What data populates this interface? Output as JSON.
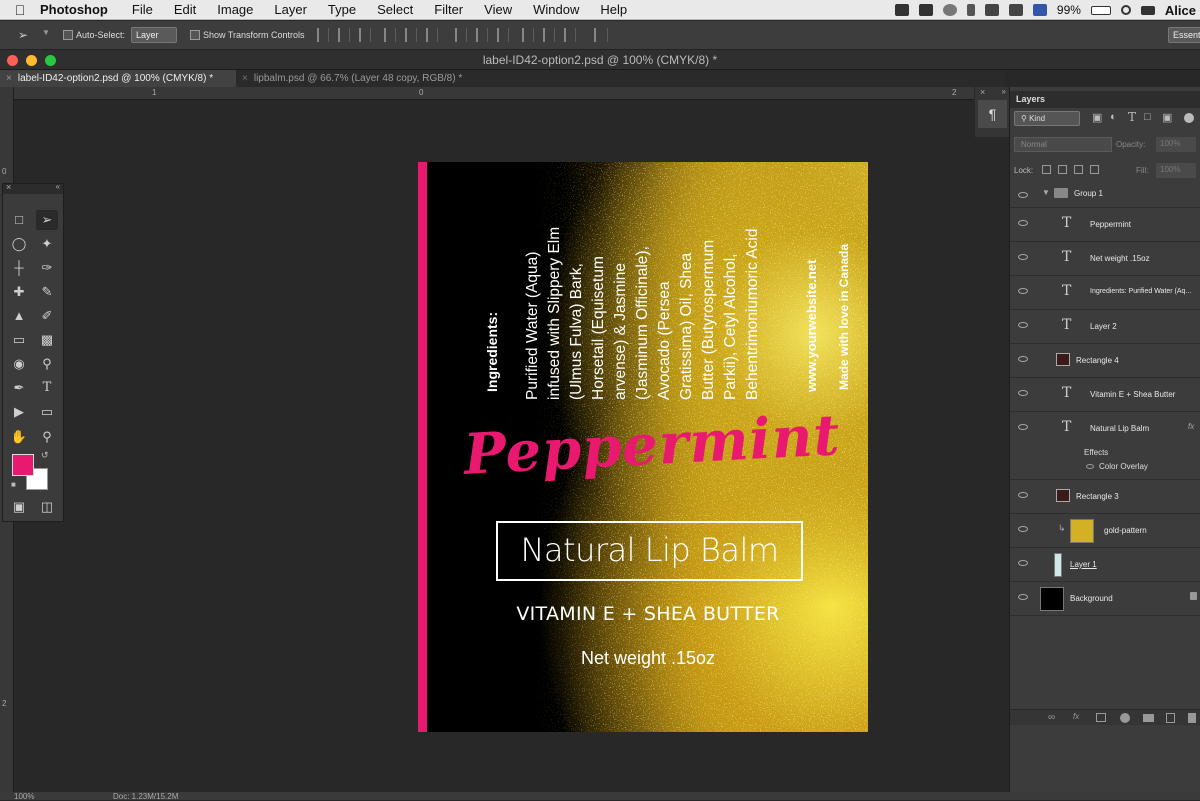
{
  "menubar": {
    "apple": "",
    "app_name": "Photoshop",
    "items": [
      "File",
      "Edit",
      "Image",
      "Layer",
      "Type",
      "Select",
      "Filter",
      "View",
      "Window",
      "Help"
    ],
    "battery": "99%",
    "user": "Alice"
  },
  "options_bar": {
    "auto_select_label": "Auto-Select:",
    "auto_select_value": "Layer",
    "show_transform_label": "Show Transform Controls",
    "workspace": "Essent"
  },
  "window": {
    "title": "label-ID42-option2.psd @ 100% (CMYK/8) *"
  },
  "tabs": [
    {
      "label": "label-ID42-option2.psd @ 100% (CMYK/8) *"
    },
    {
      "label": "lipbalm.psd @ 66.7% (Layer 48 copy, RGB/8) *"
    }
  ],
  "rulers": {
    "h": [
      "1",
      "0",
      "2"
    ],
    "v": [
      "0",
      "1",
      "2"
    ]
  },
  "label": {
    "ingredients_title": "Ingredients:",
    "ingredients_lines": [
      "Purified Water (Aqua)",
      "infused with Slippery Elm",
      "(Ulmus Fulva) Bark,",
      "Horsetail (Equisetum",
      "arvense) & Jasmine",
      "(Jasminum Officinale),",
      "Avocado (Persea",
      "Gratissima) Oil, Shea",
      "Butter (Butyrospermum",
      "Parkii), Cetyl Alcohol,",
      "Behentrimoniumoric Acid"
    ],
    "website": "www.yourwebsite.net",
    "made_with": "Made with love in Canada",
    "product_name": "Peppermint",
    "product_type": "Natural Lip Balm",
    "tagline": "VITAMIN E + SHEA BUTTER",
    "net_weight": "Net weight .15oz"
  },
  "layers_panel": {
    "title": "Layers",
    "kind": "Kind",
    "blend_mode": "Normal",
    "opacity_label": "Opacity:",
    "opacity_value": "100%",
    "lock_label": "Lock:",
    "fill_label": "Fill:",
    "fill_value": "100%",
    "layers": [
      {
        "name": "Group 1",
        "type": "group"
      },
      {
        "name": "Peppermint",
        "type": "text"
      },
      {
        "name": "Net weight .15oz",
        "type": "text"
      },
      {
        "name": "Ingredients:  Purified Water (Aq...",
        "type": "text"
      },
      {
        "name": "Layer 2",
        "type": "text"
      },
      {
        "name": "Rectangle 4",
        "type": "shape"
      },
      {
        "name": "Vitamin E + Shea Butter",
        "type": "text"
      },
      {
        "name": "Natural Lip Balm",
        "type": "text"
      },
      {
        "name": "Rectangle 3",
        "type": "shape"
      },
      {
        "name": "gold-pattern",
        "type": "image"
      },
      {
        "name": "Layer 1",
        "type": "image"
      },
      {
        "name": "Background",
        "type": "image"
      }
    ],
    "effects_label": "Effects",
    "effect_name": "Color Overlay",
    "fx": "fx"
  },
  "status": {
    "zoom": "100%",
    "doc": "Doc: 1.23M/15.2M"
  },
  "colors": {
    "foreground": "#e8196f",
    "background": "#ffffff",
    "pink": "#e8196f",
    "gold": "#e2c93a"
  }
}
